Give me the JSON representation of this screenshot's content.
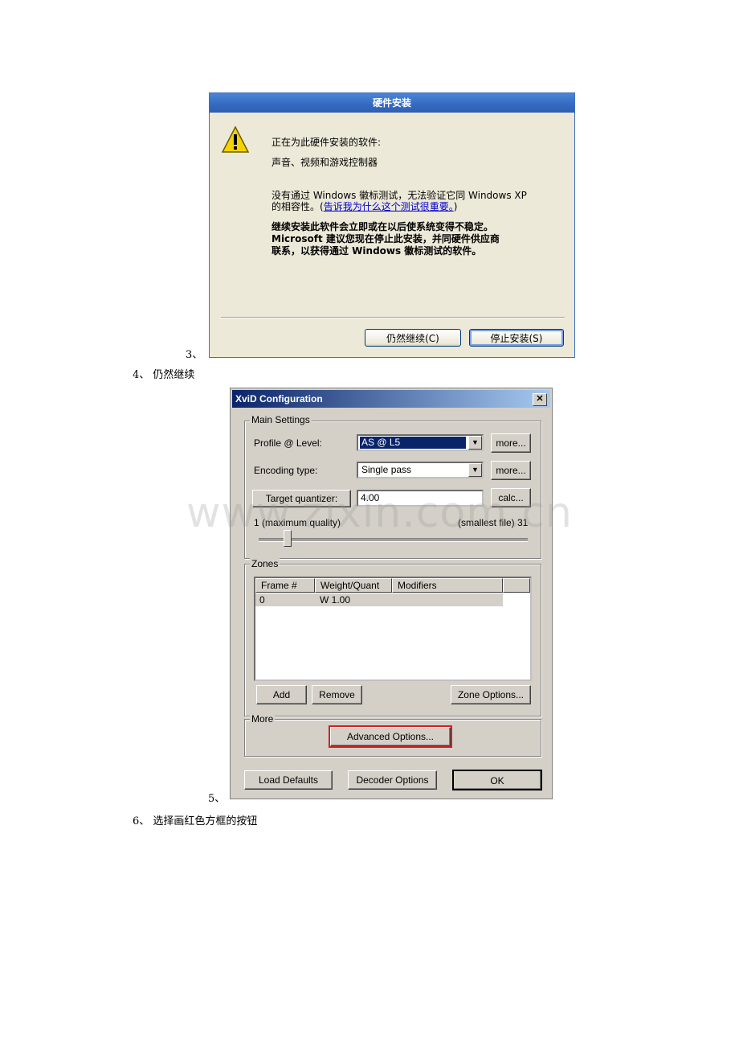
{
  "hardware_dialog": {
    "title": "硬件安装",
    "line1": "正在为此硬件安装的软件:",
    "line2": "声音、视频和游戏控制器",
    "line3a": "没有通过 Windows 徽标测试，无法验证它同 Windows XP",
    "line3b_prefix": "的相容性。(",
    "line3b_link": "告诉我为什么这个测试很重要。",
    "line3b_suffix": ")",
    "bold1": "继续安装此软件会立即或在以后使系统变得不稳定。",
    "bold2": "Microsoft 建议您现在停止此安装，并同硬件供应商",
    "bold3": "联系，以获得通过 Windows 徽标测试的软件。",
    "continue_button": "仍然继续(C)",
    "stop_button": "停止安装(S)",
    "warning_icon": "warning-icon"
  },
  "steps": {
    "step3": "3、",
    "step4": "4、 仍然继续",
    "step5": "5、",
    "step6": "6、 选择画红色方框的按钮"
  },
  "xvid": {
    "title": "XviD Configuration",
    "close": "✕",
    "main_settings": "Main Settings",
    "profile_label": "Profile @ Level:",
    "profile_value": "AS @ L5",
    "encoding_label": "Encoding type:",
    "encoding_value": "Single pass",
    "more1": "more...",
    "more2": "more...",
    "target_button": "Target quantizer:",
    "target_value": "4.00",
    "calc_button": "calc...",
    "slider_min_label": "1 (maximum quality)",
    "slider_max_label": "(smallest file) 31",
    "zones": "Zones",
    "columns": [
      "Frame #",
      "Weight/Quant",
      "Modifiers"
    ],
    "rows": [
      [
        "0",
        "W 1.00",
        ""
      ]
    ],
    "add_button": "Add",
    "remove_button": "Remove",
    "zone_options_button": "Zone Options...",
    "more_group": "More",
    "advanced_button": "Advanced Options...",
    "load_defaults_button": "Load Defaults",
    "decoder_options_button": "Decoder Options",
    "ok_button": "OK",
    "highlight_color": "#d62020"
  },
  "watermark": "www.zixin.com.cn"
}
